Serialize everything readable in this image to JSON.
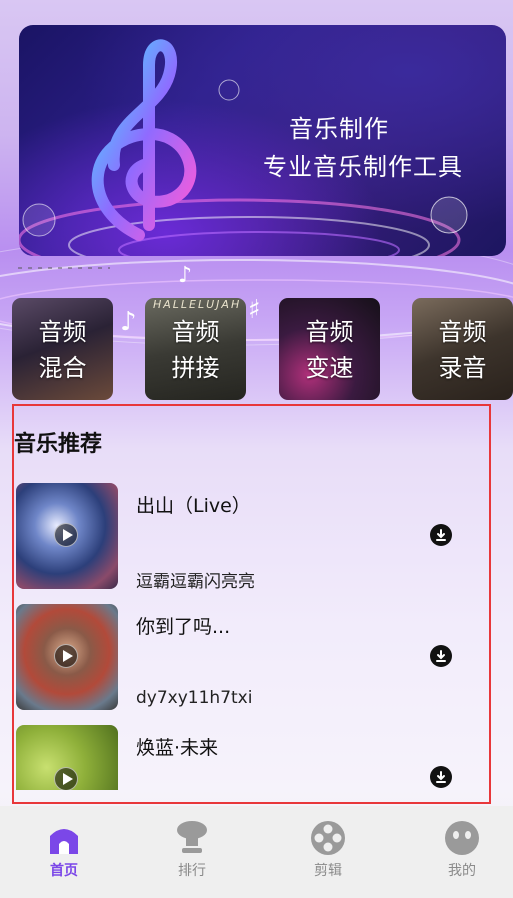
{
  "banner": {
    "title": "音乐制作",
    "subtitle": "专业音乐制作工具"
  },
  "tools": [
    {
      "line1": "音频",
      "line2": "混合"
    },
    {
      "line1": "音频",
      "line2": "拼接"
    },
    {
      "line1": "音频",
      "line2": "变速"
    },
    {
      "line1": "音频",
      "line2": "录音"
    }
  ],
  "tool_background_texts": {
    "hallelujah": "HALLELUJAH"
  },
  "recommend": {
    "title": "音乐推荐",
    "songs": [
      {
        "name": "出山（Live）",
        "artist": "逗霸逗霸闪亮亮"
      },
      {
        "name": "你到了吗...",
        "artist": "dy7xy11h7txi"
      },
      {
        "name": "焕蓝·未来",
        "artist": ""
      }
    ]
  },
  "tabbar": {
    "items": [
      {
        "label": "首页",
        "icon": "home-icon",
        "active": true
      },
      {
        "label": "排行",
        "icon": "trophy-icon",
        "active": false
      },
      {
        "label": "剪辑",
        "icon": "film-reel-icon",
        "active": false
      },
      {
        "label": "我的",
        "icon": "face-icon",
        "active": false
      }
    ]
  },
  "colors": {
    "accent": "#7b47e8",
    "highlight_border": "#e8373a",
    "tab_inactive": "#8a8a8a"
  }
}
